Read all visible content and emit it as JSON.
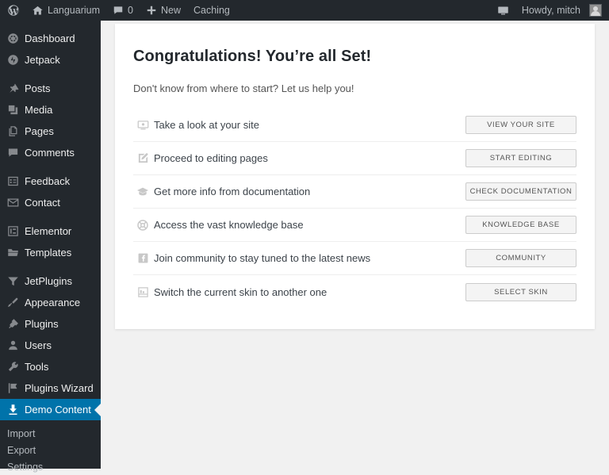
{
  "adminbar": {
    "wp_logo_icon": "wordpress-logo-icon",
    "site_home_icon": "home-icon",
    "site_name": "Languarium",
    "comments_icon": "comment-bubble-icon",
    "comments_count": "0",
    "new_icon": "plus-icon",
    "new_label": "New",
    "caching_label": "Caching",
    "screen_icon": "screen-options-icon",
    "howdy_label": "Howdy, mitch",
    "avatar_icon": "user-avatar"
  },
  "sidebar": {
    "groups": [
      {
        "items": [
          {
            "label": "Dashboard",
            "icon": "dashboard-icon",
            "active": false
          },
          {
            "label": "Jetpack",
            "icon": "jetpack-icon",
            "active": false
          }
        ]
      },
      {
        "items": [
          {
            "label": "Posts",
            "icon": "pin-icon",
            "active": false
          },
          {
            "label": "Media",
            "icon": "media-icon",
            "active": false
          },
          {
            "label": "Pages",
            "icon": "pages-icon",
            "active": false
          },
          {
            "label": "Comments",
            "icon": "comment-bubble-icon",
            "active": false
          }
        ]
      },
      {
        "items": [
          {
            "label": "Feedback",
            "icon": "feedback-icon",
            "active": false
          },
          {
            "label": "Contact",
            "icon": "envelope-icon",
            "active": false
          }
        ]
      },
      {
        "items": [
          {
            "label": "Elementor",
            "icon": "elementor-icon",
            "active": false
          },
          {
            "label": "Templates",
            "icon": "folder-icon",
            "active": false
          }
        ]
      },
      {
        "items": [
          {
            "label": "JetPlugins",
            "icon": "funnel-icon",
            "active": false
          },
          {
            "label": "Appearance",
            "icon": "paintbrush-icon",
            "active": false
          },
          {
            "label": "Plugins",
            "icon": "plugin-icon",
            "active": false
          },
          {
            "label": "Users",
            "icon": "user-icon",
            "active": false
          },
          {
            "label": "Tools",
            "icon": "wrench-icon",
            "active": false
          },
          {
            "label": "Plugins Wizard",
            "icon": "flag-icon",
            "active": false
          },
          {
            "label": "Demo Content",
            "icon": "download-icon",
            "active": true
          }
        ]
      }
    ],
    "submenu": [
      {
        "label": "Import"
      },
      {
        "label": "Export"
      },
      {
        "label": "Settings"
      }
    ],
    "active_color": "#0073aa",
    "background_color": "#23282d"
  },
  "main": {
    "title": "Congratulations! You’re all Set!",
    "subtitle": "Don't know from where to start? Let us help you!",
    "rows": [
      {
        "icon": "monitor-icon",
        "label": "Take a look at your site",
        "button": "VIEW YOUR SITE"
      },
      {
        "icon": "edit-pencil-icon",
        "label": "Proceed to editing pages",
        "button": "START EDITING"
      },
      {
        "icon": "graduation-cap-icon",
        "label": "Get more info from documentation",
        "button": "CHECK DOCUMENTATION"
      },
      {
        "icon": "lifebuoy-icon",
        "label": "Access the vast knowledge base",
        "button": "KNOWLEDGE BASE"
      },
      {
        "icon": "facebook-icon",
        "label": "Join community to stay tuned to the latest news",
        "button": "COMMUNITY"
      },
      {
        "icon": "layout-skin-icon",
        "label": "Switch the current skin to another one",
        "button": "SELECT SKIN"
      }
    ]
  }
}
